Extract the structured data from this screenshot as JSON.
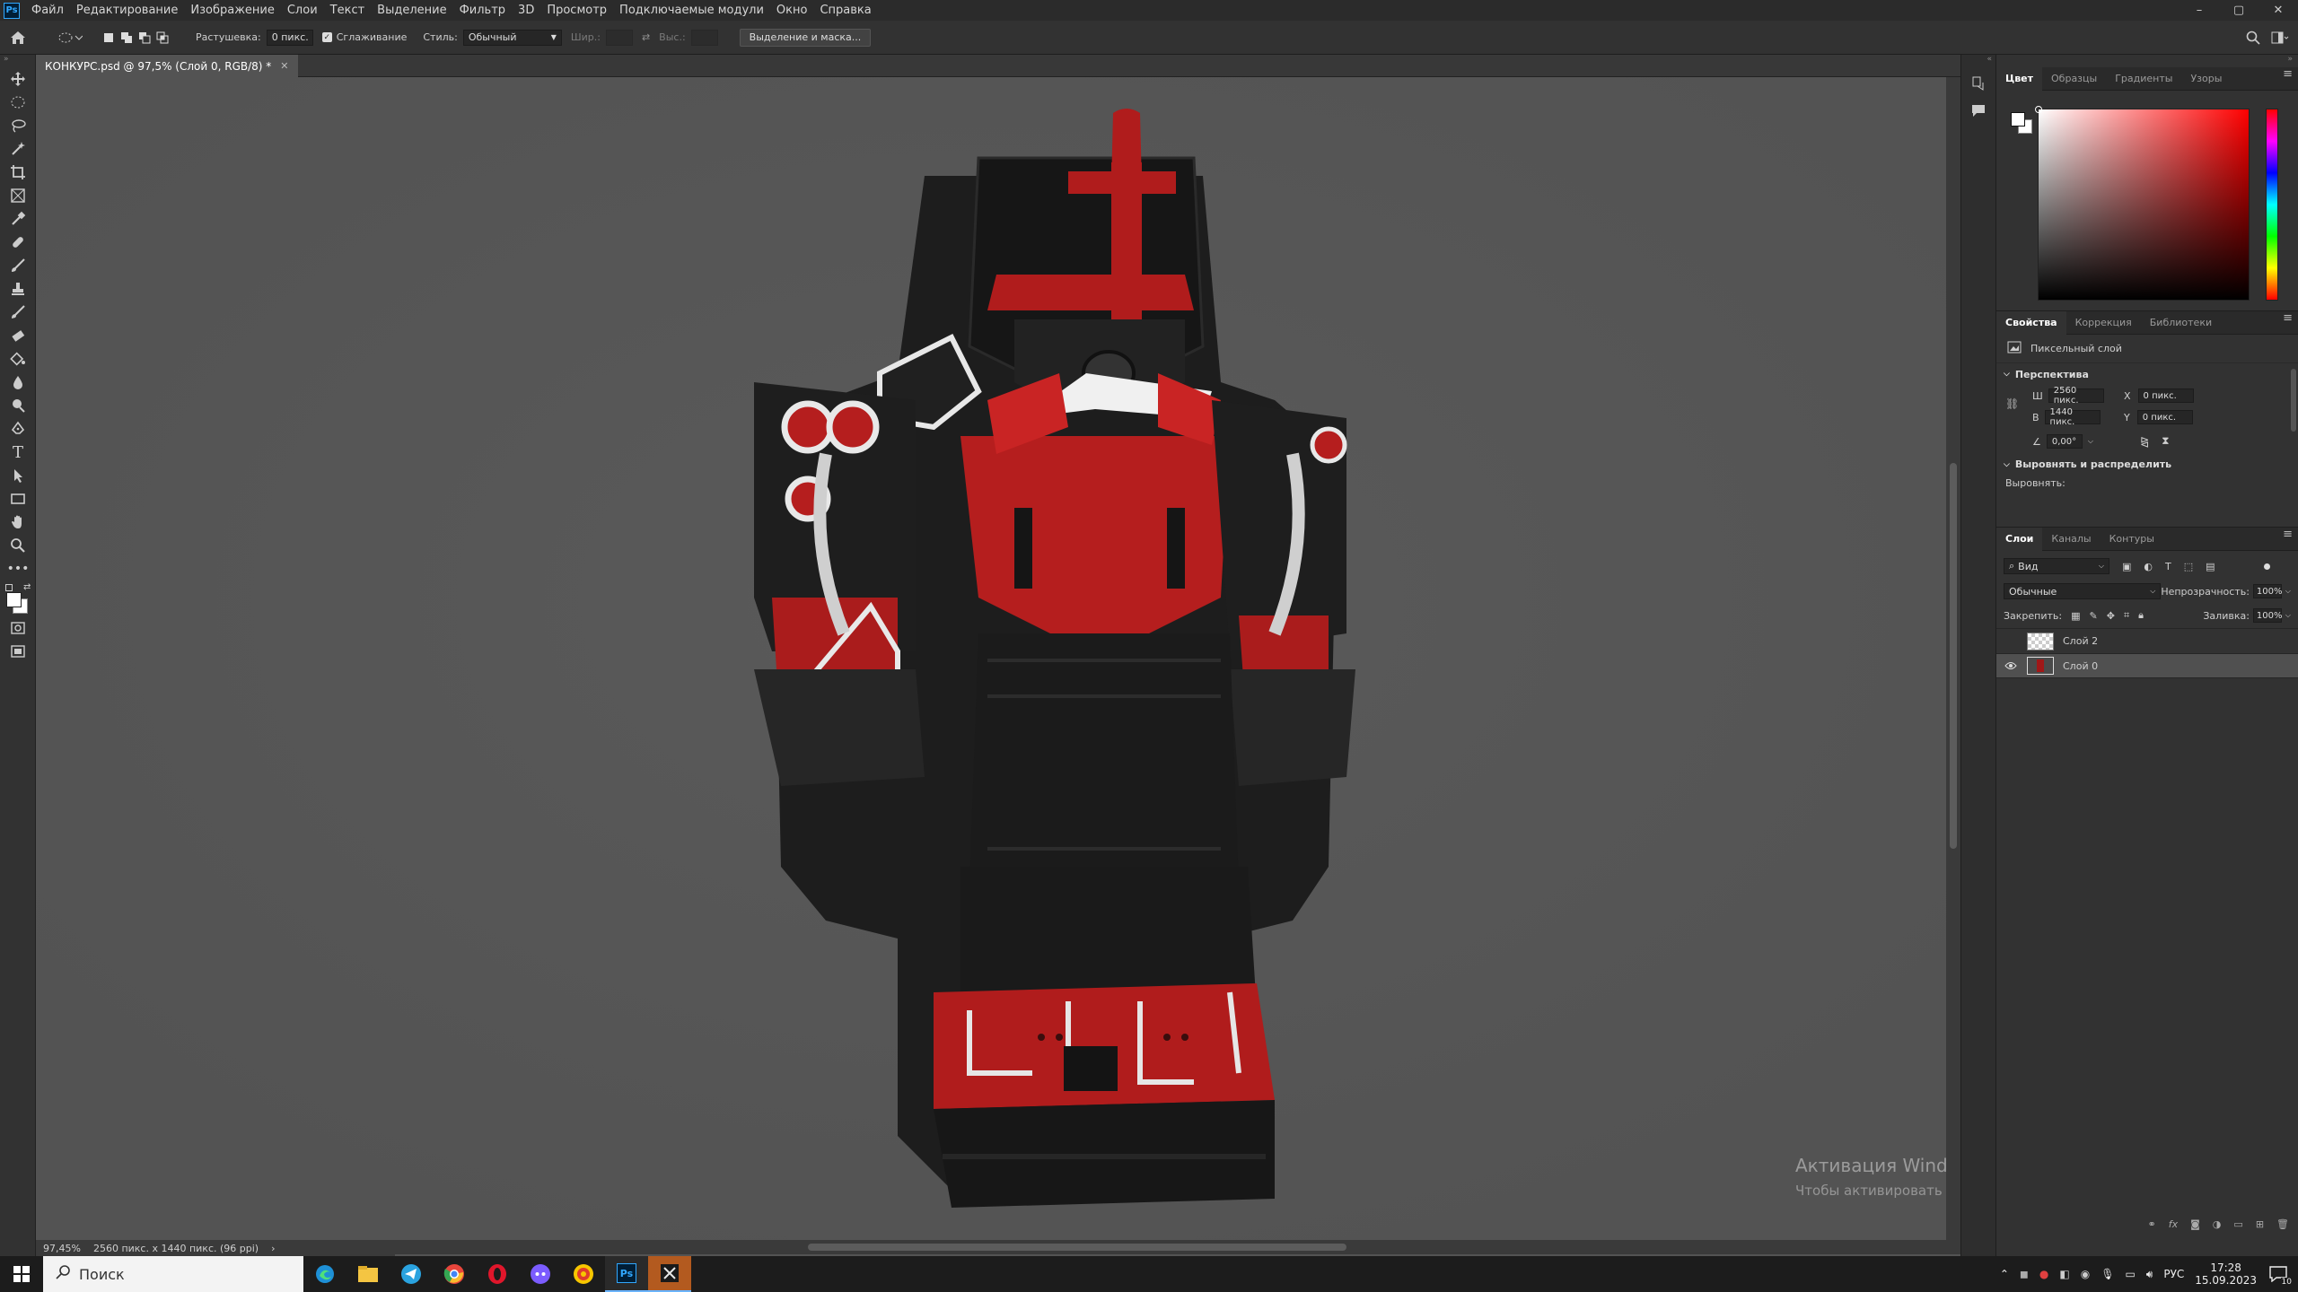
{
  "menu": {
    "items": [
      "Файл",
      "Редактирование",
      "Изображение",
      "Слои",
      "Текст",
      "Выделение",
      "Фильтр",
      "3D",
      "Просмотр",
      "Подключаемые модули",
      "Окно",
      "Справка"
    ],
    "win_min": "–",
    "win_max": "▢",
    "win_close": "✕"
  },
  "options": {
    "feather_label": "Растушевка:",
    "feather_value": "0 пикс.",
    "antialias_label": "Сглаживание",
    "style_label": "Стиль:",
    "style_value": "Обычный",
    "width_label": "Шир.:",
    "height_label": "Выс.:",
    "select_mask_button": "Выделение и маска..."
  },
  "document": {
    "tab_title": "КОНКУРС.psd @ 97,5% (Слой 0, RGB/8) *",
    "zoom": "97,45%",
    "doc_info": "2560 пикс. x 1440 пикс. (96 ppi)"
  },
  "color_panel": {
    "tabs": [
      "Цвет",
      "Образцы",
      "Градиенты",
      "Узоры"
    ],
    "hue": "#ff0000"
  },
  "properties_panel": {
    "tabs": [
      "Свойства",
      "Коррекция",
      "Библиотеки"
    ],
    "layer_kind": "Пиксельный слой",
    "section_transform": "Перспектива",
    "w_label": "Ш",
    "w_value": "2560 пикс.",
    "h_label": "В",
    "h_value": "1440 пикс.",
    "x_label": "X",
    "x_value": "0 пикс.",
    "y_label": "Y",
    "y_value": "0 пикс.",
    "angle_value": "0,00°",
    "section_align": "Выровнять и распределить",
    "align_label": "Выровнять:"
  },
  "layers_panel": {
    "tabs": [
      "Слои",
      "Каналы",
      "Контуры"
    ],
    "filter_value": "Вид",
    "blend_mode": "Обычные",
    "opacity_label": "Непрозрачность:",
    "opacity_value": "100%",
    "lock_label": "Закрепить:",
    "fill_label": "Заливка:",
    "fill_value": "100%",
    "layers": [
      {
        "name": "Слой 2",
        "visible": false,
        "selected": false
      },
      {
        "name": "Слой 0",
        "visible": true,
        "selected": true
      }
    ]
  },
  "watermark": {
    "title": "Активация Windows",
    "subtitle": "Чтобы активировать Windows, перейдите в раздел \"Параметры\"."
  },
  "taskbar": {
    "search_placeholder": "Поиск",
    "lang": "РУС",
    "time": "17:28",
    "date": "15.09.2023",
    "notif_count": "10"
  }
}
